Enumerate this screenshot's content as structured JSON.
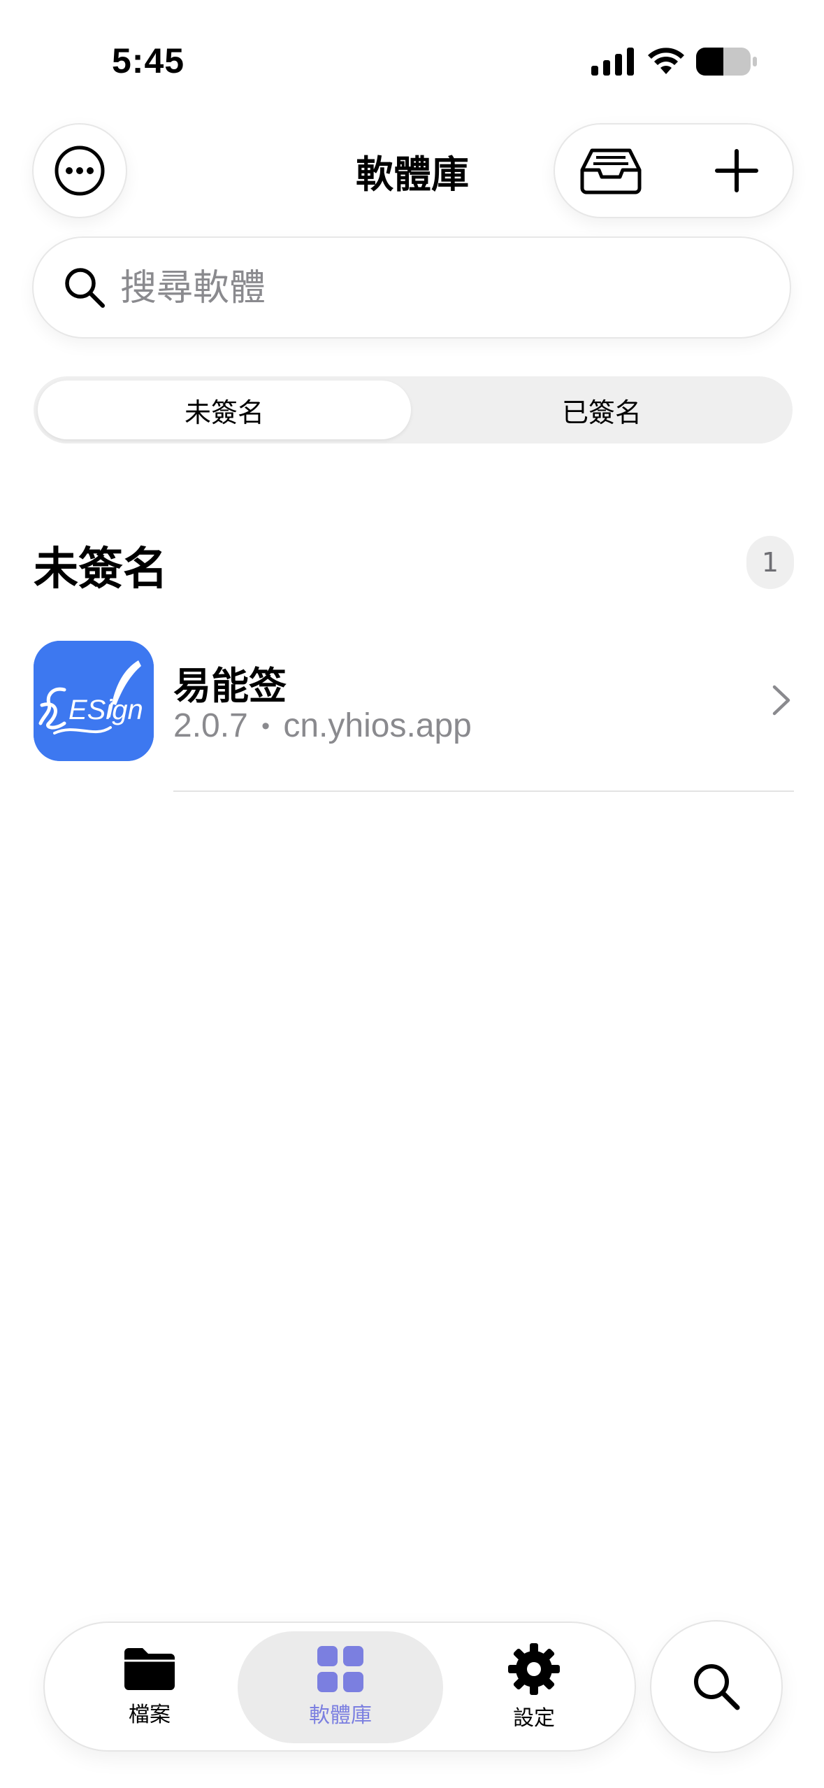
{
  "status_bar": {
    "time": "5:45"
  },
  "header": {
    "title": "軟體庫",
    "more_icon": "ellipsis-circle-icon",
    "inbox_icon": "tray-icon",
    "add_icon": "plus-icon"
  },
  "search": {
    "placeholder": "搜尋軟體",
    "value": ""
  },
  "segments": [
    {
      "label": "未簽名",
      "selected": true
    },
    {
      "label": "已簽名",
      "selected": false
    }
  ],
  "section": {
    "title": "未簽名",
    "count": "1"
  },
  "apps": [
    {
      "name": "易能签",
      "version": "2.0.7",
      "separator": "•",
      "bundle_id": "cn.yhios.app",
      "icon_text": "ESign"
    }
  ],
  "tab_bar": {
    "tabs": [
      {
        "label": "檔案",
        "icon": "folder-icon",
        "selected": false
      },
      {
        "label": "軟體庫",
        "icon": "grid-icon",
        "selected": true
      },
      {
        "label": "設定",
        "icon": "gear-icon",
        "selected": false
      }
    ],
    "search_icon": "search-icon"
  },
  "colors": {
    "accent": "#7b7fe0",
    "app_icon_bg": "#3d78f0",
    "secondary_text": "#8a8a8e"
  }
}
